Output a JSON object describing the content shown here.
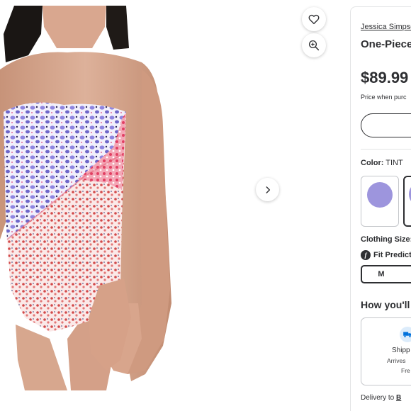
{
  "product": {
    "brand": "Jessica Simpso",
    "title": "One-Piece",
    "price": "$89.99",
    "price_note": "Price when purc"
  },
  "actions": {
    "favorite_icon": "heart-icon",
    "zoom_icon": "zoom-in-icon",
    "next_icon": "chevron-right-icon"
  },
  "color": {
    "label": "Color:",
    "value": "TINT",
    "swatch_color": "#9d95dd"
  },
  "size": {
    "label": "Clothing Size:",
    "fit_label": "Fit Predict",
    "selected": "M"
  },
  "fulfillment": {
    "title": "How you'll",
    "shipping_label": "Shipp",
    "arrives_text": "Arrives",
    "free_text": "Fre",
    "delivery_prefix": "Delivery to",
    "delivery_link": "B"
  },
  "colors": {
    "text": "#2e2f32",
    "border": "#c5c7cb",
    "ship_icon": "#0071dc"
  }
}
